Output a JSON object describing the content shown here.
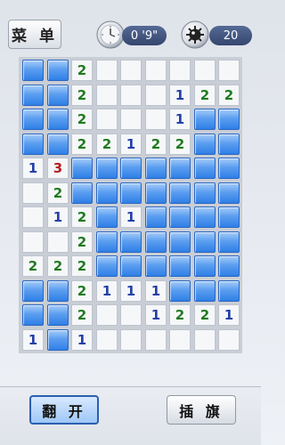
{
  "header": {
    "menu_label": "菜 单",
    "timer_value": "0 '9\"",
    "mines_remaining": "20",
    "timer_icon": "clock-icon",
    "mines_icon": "mine-icon"
  },
  "board": {
    "cols": 9,
    "rows": 12,
    "cells": [
      [
        "C",
        "C",
        "2",
        "O",
        "O",
        "O",
        "O",
        "O",
        "O"
      ],
      [
        "C",
        "C",
        "2",
        "O",
        "O",
        "O",
        "1",
        "2",
        "2"
      ],
      [
        "C",
        "C",
        "2",
        "O",
        "O",
        "O",
        "1",
        "C",
        "C"
      ],
      [
        "C",
        "C",
        "2",
        "2",
        "1",
        "2",
        "2",
        "C",
        "C"
      ],
      [
        "1",
        "3",
        "C",
        "C",
        "C",
        "C",
        "C",
        "C",
        "C"
      ],
      [
        "O",
        "2",
        "C",
        "C",
        "C",
        "C",
        "C",
        "C",
        "C"
      ],
      [
        "O",
        "1",
        "2",
        "C",
        "1",
        "C",
        "C",
        "C",
        "C"
      ],
      [
        "O",
        "O",
        "2",
        "C",
        "C",
        "C",
        "C",
        "C",
        "C"
      ],
      [
        "2",
        "2",
        "2",
        "C",
        "C",
        "C",
        "C",
        "C",
        "C"
      ],
      [
        "C",
        "C",
        "2",
        "1",
        "1",
        "1",
        "C",
        "C",
        "C"
      ],
      [
        "C",
        "C",
        "2",
        "O",
        "O",
        "1",
        "2",
        "2",
        "1"
      ],
      [
        "1",
        "C",
        "1",
        "O",
        "O",
        "O",
        "O",
        "O",
        "O"
      ]
    ]
  },
  "footer": {
    "reveal_label": "翻 开",
    "flag_label": "插 旗"
  },
  "colors": {
    "covered": "#4a90e8",
    "number_1": "#2440a8",
    "number_2": "#1f7a1f",
    "number_3": "#b32020"
  }
}
